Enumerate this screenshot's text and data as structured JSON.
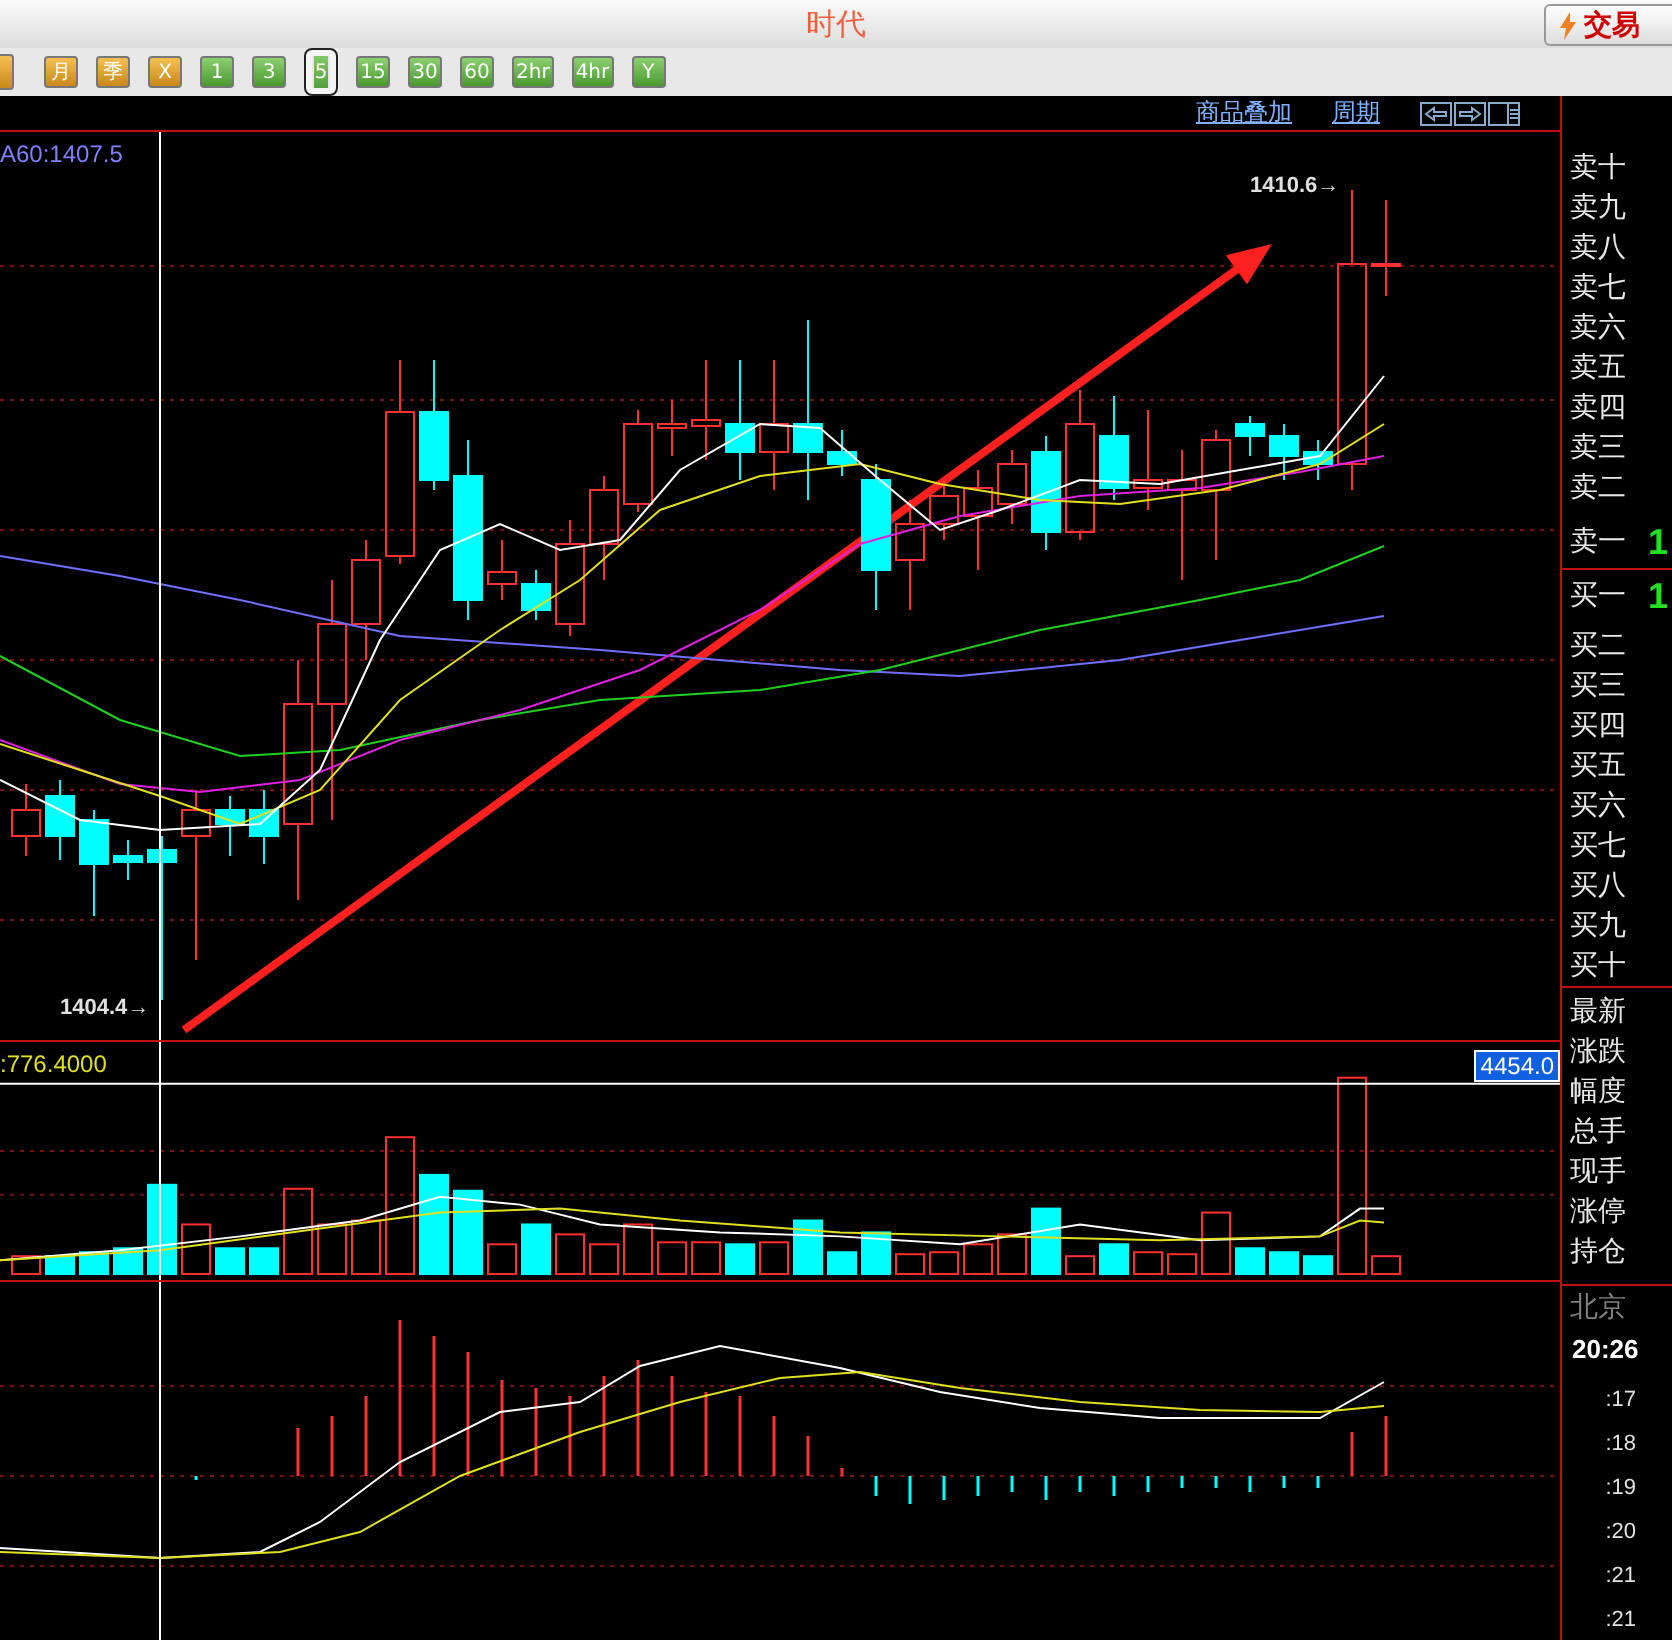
{
  "title_bar": {
    "title": "时代",
    "trade_button": "交易"
  },
  "period_buttons": [
    {
      "label": "月",
      "kind": "long",
      "selected": false
    },
    {
      "label": "季",
      "kind": "long",
      "selected": false
    },
    {
      "label": "X",
      "kind": "long",
      "selected": false
    },
    {
      "label": "1",
      "kind": "minute",
      "selected": false
    },
    {
      "label": "3",
      "kind": "minute",
      "selected": false
    },
    {
      "label": "5",
      "kind": "minute",
      "selected": true
    },
    {
      "label": "15",
      "kind": "minute",
      "selected": false
    },
    {
      "label": "30",
      "kind": "minute",
      "selected": false
    },
    {
      "label": "60",
      "kind": "minute",
      "selected": false
    },
    {
      "label": "2hr",
      "kind": "minute",
      "selected": false
    },
    {
      "label": "4hr",
      "kind": "minute",
      "selected": false
    },
    {
      "label": "Y",
      "kind": "minute",
      "selected": false
    }
  ],
  "chart_header": {
    "links": [
      "商品叠加",
      "周期"
    ]
  },
  "price_chart": {
    "ma_label": "A60:1407.5",
    "high_label": "1410.6→",
    "low_label": "1404.4→"
  },
  "volume_chart": {
    "label": ":776.4000",
    "current_value": "4454.0"
  },
  "quote_panel": {
    "sell_levels": [
      {
        "label": "卖十"
      },
      {
        "label": "卖九"
      },
      {
        "label": "卖八"
      },
      {
        "label": "卖七"
      },
      {
        "label": "卖六"
      },
      {
        "label": "卖五"
      },
      {
        "label": "卖四"
      },
      {
        "label": "卖三"
      },
      {
        "label": "卖二"
      },
      {
        "label": "卖一",
        "value": "1"
      }
    ],
    "buy_levels": [
      {
        "label": "买一",
        "value": "1"
      },
      {
        "label": "买二"
      },
      {
        "label": "买三"
      },
      {
        "label": "买四"
      },
      {
        "label": "买五"
      },
      {
        "label": "买六"
      },
      {
        "label": "买七"
      },
      {
        "label": "买八"
      },
      {
        "label": "买九"
      },
      {
        "label": "买十"
      }
    ],
    "fields": [
      "最新",
      "涨跌",
      "幅度",
      "总手",
      "现手",
      "涨停",
      "持仓"
    ],
    "timezone": "北京",
    "time": "20:26",
    "time_ticks": [
      ":17",
      ":18",
      ":19",
      ":20",
      ":21",
      ":21"
    ]
  }
}
